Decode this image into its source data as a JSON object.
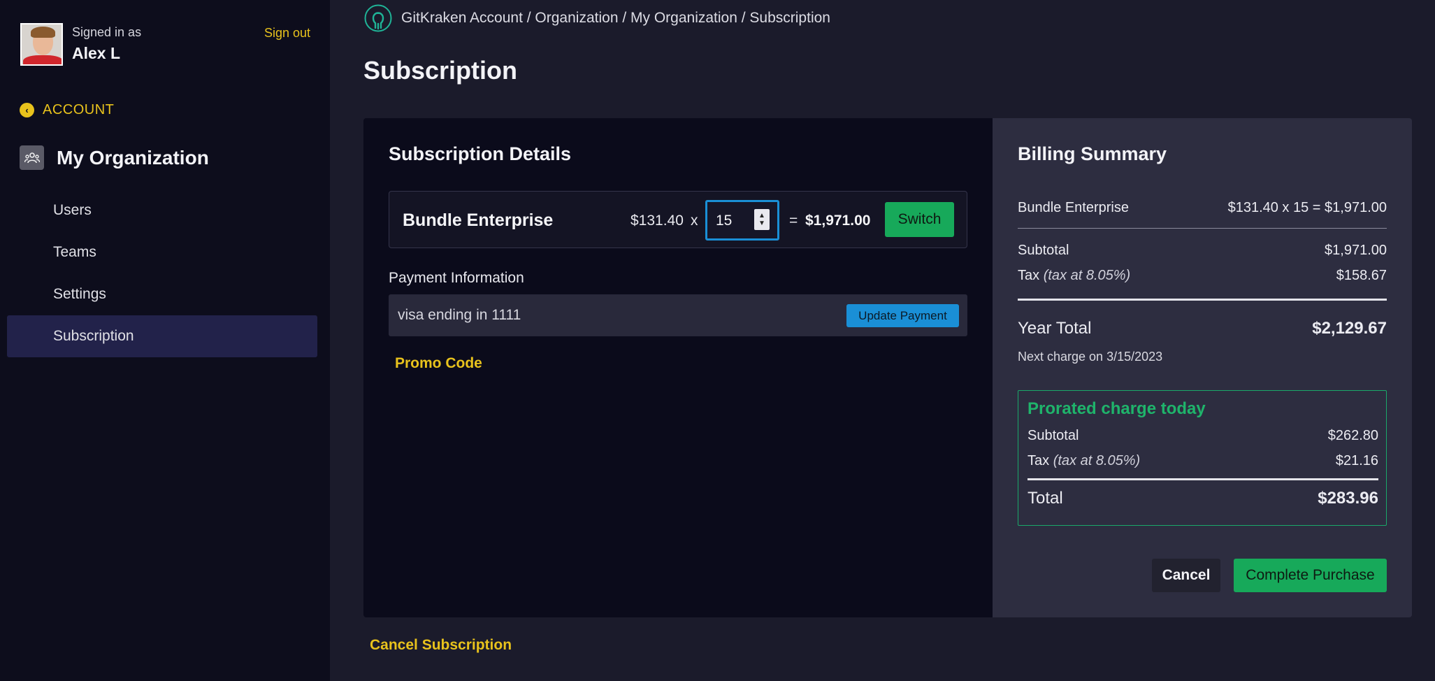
{
  "user": {
    "signed_in_label": "Signed in as",
    "name": "Alex L",
    "sign_out": "Sign out"
  },
  "sidebar": {
    "back_label": "ACCOUNT",
    "org_name": "My Organization",
    "items": [
      {
        "label": "Users"
      },
      {
        "label": "Teams"
      },
      {
        "label": "Settings"
      },
      {
        "label": "Subscription",
        "active": true
      }
    ]
  },
  "breadcrumb": "GitKraken Account / Organization / My Organization / Subscription",
  "page_title": "Subscription",
  "details": {
    "title": "Subscription Details",
    "product": "Bundle Enterprise",
    "unit_price": "$131.40",
    "times": "x",
    "quantity": "15",
    "equals": "=",
    "line_total": "$1,971.00",
    "switch_label": "Switch",
    "payment_label": "Payment Information",
    "payment_method": "visa ending in 1111",
    "update_payment_label": "Update Payment",
    "promo_label": "Promo Code"
  },
  "billing": {
    "title": "Billing Summary",
    "product_line_label": "Bundle Enterprise",
    "product_line_value": "$131.40 x 15 = $1,971.00",
    "subtotal_label": "Subtotal",
    "subtotal_value": "$1,971.00",
    "tax_label": "Tax",
    "tax_note": "(tax at 8.05%)",
    "tax_value": "$158.67",
    "year_total_label": "Year Total",
    "year_total_value": "$2,129.67",
    "next_charge": "Next charge on 3/15/2023",
    "prorated": {
      "title": "Prorated charge today",
      "subtotal_label": "Subtotal",
      "subtotal_value": "$262.80",
      "tax_label": "Tax",
      "tax_note": "(tax at 8.05%)",
      "tax_value": "$21.16",
      "total_label": "Total",
      "total_value": "$283.96"
    },
    "cancel_label": "Cancel",
    "purchase_label": "Complete Purchase"
  },
  "cancel_subscription_label": "Cancel Subscription",
  "colors": {
    "accent_yellow": "#e8c21c",
    "success_green": "#17a95a",
    "info_blue": "#1a8fd6",
    "sidebar_bg": "#0d0d1c",
    "page_bg": "#1b1b2b"
  },
  "icons": {
    "account_back": "chevron-left-circle-icon",
    "org": "users-group-icon",
    "logo": "gitkraken-logo-icon",
    "spinner": "spinner-arrows-icon"
  }
}
